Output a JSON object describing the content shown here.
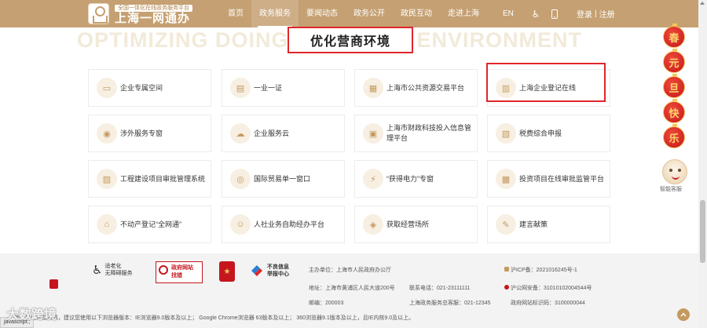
{
  "header": {
    "logo_sub": "全国一体化在线政务服务平台",
    "logo_main": "上海一网通办",
    "nav": [
      "首页",
      "政务服务",
      "要闻动态",
      "政务公开",
      "政民互动",
      "走进上海"
    ],
    "lang": "EN",
    "login": "登录",
    "separator": "|",
    "register": "注册"
  },
  "section": {
    "bg_text": "OPTIMIZING DOING BUSINESS ENVIRONMENT",
    "title": "优化营商环境"
  },
  "services": [
    {
      "label": "企业专属空间",
      "icon": "monitor-icon"
    },
    {
      "label": "一业一证",
      "icon": "certificate-icon"
    },
    {
      "label": "上海市公共资源交易平台",
      "icon": "trade-icon"
    },
    {
      "label": "上海企业登记在线",
      "icon": "building-icon"
    },
    {
      "label": "涉外服务专窗",
      "icon": "globe-person-icon"
    },
    {
      "label": "企业服务云",
      "icon": "cloud-icon"
    },
    {
      "label": "上海市财政科技投入信息管理平台",
      "icon": "finance-icon"
    },
    {
      "label": "税费综合申报",
      "icon": "tax-icon"
    },
    {
      "label": "工程建设项目审批管理系统",
      "icon": "construction-icon"
    },
    {
      "label": "国际贸易单一窗口",
      "icon": "trade-window-icon"
    },
    {
      "label": "“获得电力”专窗",
      "icon": "power-icon"
    },
    {
      "label": "投资项目在线审批监管平台",
      "icon": "investment-icon"
    },
    {
      "label": "不动产登记“全网通”",
      "icon": "house-icon"
    },
    {
      "label": "人社业务自助经办平台",
      "icon": "person-icon"
    },
    {
      "label": "获取经营场所",
      "icon": "location-icon"
    },
    {
      "label": "建言献策",
      "icon": "suggest-icon"
    }
  ],
  "float": {
    "lanterns": [
      "春",
      "元",
      "旦",
      "快",
      "乐"
    ],
    "robot_label": "智能客服"
  },
  "footer": {
    "badges": [
      {
        "text": "适老化\n无障碍服务"
      },
      {
        "text": "政府网站\n找错"
      },
      {
        "text": ""
      },
      {
        "text": "不良信息\n举报中心"
      }
    ],
    "sponsor": "主办单位：上海市人民政府办公厅",
    "address": "地址：上海市黄浦区人民大道200号",
    "postcode": "邮编：200003",
    "phone": "联系电话：021-23111111",
    "complaint": "上海政务服务总客服：021-12345",
    "icp": "沪ICP备：2021016245号-1",
    "police": "沪公网安备：31010102004544号",
    "site_code": "政府网站标识码：3100000044",
    "browser_note": "确保最佳浏览效果，建议您使用以下浏览器版本：IE浏览器9.0版本及以上；  Google Chrome浏览器 63版本及以上；  360浏览器9.1版本及以上，且IE内核9.0及以上。"
  },
  "status": {
    "js": "javascript:;",
    "watermark": "大数跨境"
  }
}
